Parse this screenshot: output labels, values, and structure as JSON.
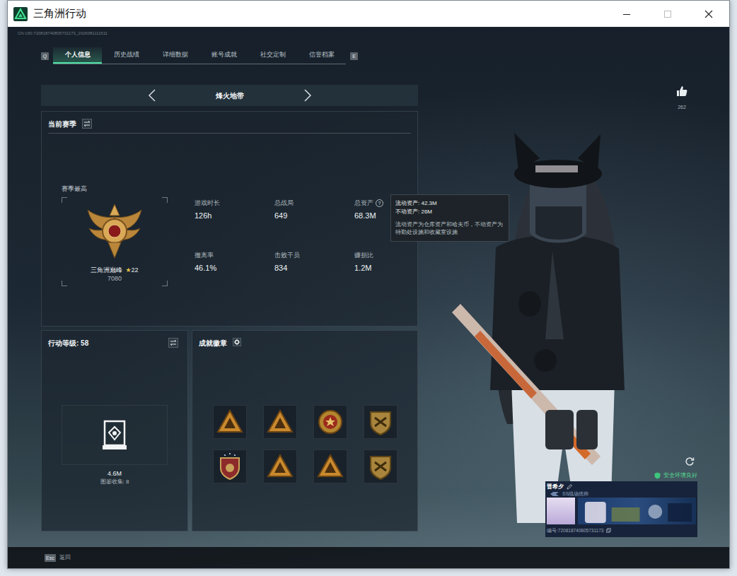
{
  "window": {
    "title": "三角洲行动"
  },
  "uid": "CN UID:720818740805731173_2026081111511",
  "tabs": {
    "prev_key": "Q",
    "next_key": "E",
    "items": [
      {
        "label": "个人信息",
        "selected": true
      },
      {
        "label": "历史战绩",
        "selected": false
      },
      {
        "label": "详细数据",
        "selected": false
      },
      {
        "label": "账号成就",
        "selected": false
      },
      {
        "label": "社交定制",
        "selected": false
      },
      {
        "label": "信誉档案",
        "selected": false
      }
    ]
  },
  "mode": {
    "title": "烽火地带"
  },
  "season": {
    "title": "当前赛季",
    "rank": {
      "label": "赛季最高",
      "name": "三角洲巅峰",
      "star": "★",
      "stars": "22",
      "points": "7080"
    },
    "stats": [
      {
        "label": "游戏时长",
        "value": "126h"
      },
      {
        "label": "总战局",
        "value": "649"
      },
      {
        "label": "总资产",
        "value": "68.3M",
        "help": "?"
      },
      {
        "label": "撤离率",
        "value": "46.1%"
      },
      {
        "label": "击败干员",
        "value": "834"
      },
      {
        "label": "赚损比",
        "value": "1.2M"
      }
    ]
  },
  "tooltip": {
    "lines": [
      "流动资产: 42.3M",
      "不动资产: 26M"
    ],
    "note": "流动资产为仓库资产和哈夫币，不动资产为特勤处设施和收藏室设施"
  },
  "level": {
    "title": "行动等级: 58",
    "value": "4.6M",
    "caption": "图鉴收集: 8"
  },
  "badges": {
    "title": "成就徽章",
    "items": [
      {
        "kind": "triangle"
      },
      {
        "kind": "triangle"
      },
      {
        "kind": "medal"
      },
      {
        "kind": "shield"
      },
      {
        "kind": "crest"
      },
      {
        "kind": "triangle"
      },
      {
        "kind": "triangle"
      },
      {
        "kind": "shield"
      }
    ]
  },
  "likes": {
    "count": "262"
  },
  "player": {
    "safety": "安全环境良好",
    "name": "晋希夕",
    "title": "SS战场统帅",
    "id": "编号:720818740805731173"
  },
  "footer": {
    "key": "Esc",
    "label": "返回"
  }
}
